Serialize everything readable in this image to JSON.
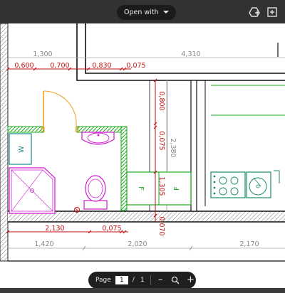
{
  "toolbar": {
    "open_with_label": "Open with",
    "icons": [
      "drive-add-icon",
      "new-window-icon"
    ]
  },
  "plan": {
    "top_dimensions": [
      "1,300",
      "4,310"
    ],
    "top_red_dimensions": [
      "0,600",
      "0,700",
      "0,830",
      "0,075"
    ],
    "vertical_red_dimensions": [
      "0,800",
      "0,075",
      "1,305",
      "0,070"
    ],
    "vertical_gray_dimension": "2,380",
    "bottom_red_dimensions": [
      "2,130",
      "0,075"
    ],
    "bottom_dimensions": [
      "1,420",
      "2,020",
      "2,170"
    ],
    "fixture_labels": {
      "washer": "W",
      "fridge_left": "F",
      "fridge_right": "F"
    }
  },
  "pager": {
    "page_label": "Page",
    "current_page": "1",
    "separator": "/",
    "total_pages": "1",
    "zoom_out": "–",
    "zoom_in": "+"
  }
}
